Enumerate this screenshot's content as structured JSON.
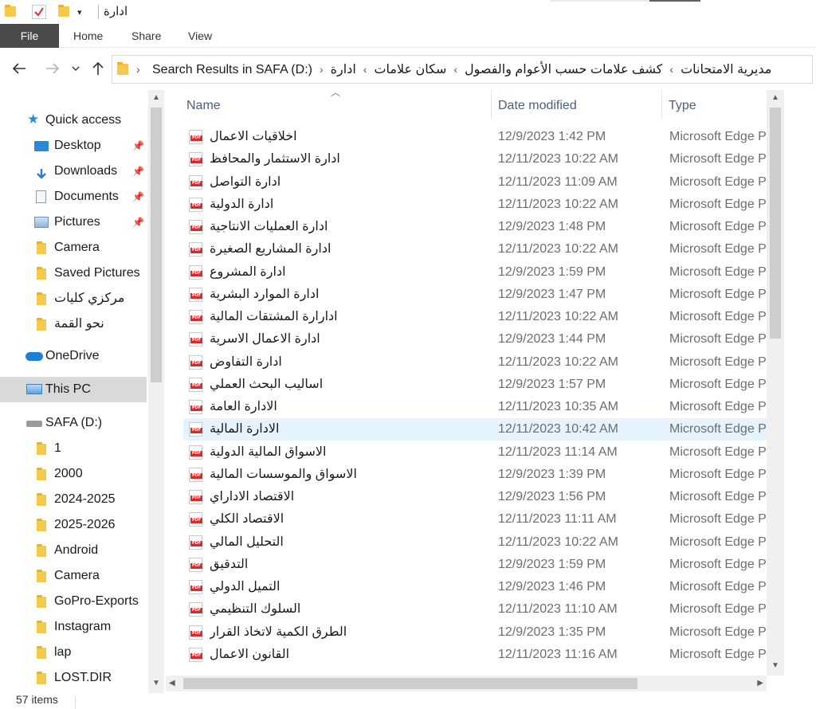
{
  "window": {
    "title": "ادارة"
  },
  "ribbon": {
    "tabs": [
      "File",
      "Home",
      "Share",
      "View"
    ]
  },
  "address": {
    "crumbs": [
      "Search Results in SAFA (D:)",
      "مديرية الامتحانات",
      "كشف علامات حسب الأعوام والفصول",
      "سكان علامات",
      "ادارة"
    ]
  },
  "nav": {
    "quick_access": "Quick access",
    "pinned": [
      {
        "label": "Desktop",
        "icon": "desktop-icon"
      },
      {
        "label": "Downloads",
        "icon": "download-icon"
      },
      {
        "label": "Documents",
        "icon": "document-icon"
      },
      {
        "label": "Pictures",
        "icon": "pictures-icon"
      }
    ],
    "folders": [
      "Camera",
      "Saved Pictures",
      "مركزي كليات",
      "نحو القمة"
    ],
    "onedrive": "OneDrive",
    "this_pc": "This PC",
    "drive": "SAFA (D:)",
    "drive_folders": [
      "1",
      "2000",
      "2024-2025",
      "2025-2026",
      "Android",
      "Camera",
      "GoPro-Exports",
      "Instagram",
      "lap",
      "LOST.DIR"
    ]
  },
  "columns": {
    "name": "Name",
    "date": "Date modified",
    "type": "Type"
  },
  "files": [
    {
      "name": "اخلاقيات الاعمال",
      "date": "12/9/2023 1:42 PM",
      "type": "Microsoft Edge P"
    },
    {
      "name": "ادارة الاستثمار والمحافظ",
      "date": "12/11/2023 10:22 AM",
      "type": "Microsoft Edge P"
    },
    {
      "name": "ادارة التواصل",
      "date": "12/11/2023 11:09 AM",
      "type": "Microsoft Edge P"
    },
    {
      "name": "ادارة الدولية",
      "date": "12/11/2023 10:22 AM",
      "type": "Microsoft Edge P"
    },
    {
      "name": "ادارة العمليات الانتاجية",
      "date": "12/9/2023 1:48 PM",
      "type": "Microsoft Edge P"
    },
    {
      "name": "ادارة المشاريع الصغيرة",
      "date": "12/11/2023 10:22 AM",
      "type": "Microsoft Edge P"
    },
    {
      "name": "ادارة المشروع",
      "date": "12/9/2023 1:59 PM",
      "type": "Microsoft Edge P"
    },
    {
      "name": "ادارة الموارد البشرية",
      "date": "12/9/2023 1:47 PM",
      "type": "Microsoft Edge P"
    },
    {
      "name": "ادارارة المشتقات المالية",
      "date": "12/11/2023 10:22 AM",
      "type": "Microsoft Edge P"
    },
    {
      "name": "ادارة الاعمال الاسرية",
      "date": "12/9/2023 1:44 PM",
      "type": "Microsoft Edge P"
    },
    {
      "name": "ادارة التفاوض",
      "date": "12/11/2023 10:22 AM",
      "type": "Microsoft Edge P"
    },
    {
      "name": "اساليب البحث العملي",
      "date": "12/9/2023 1:57 PM",
      "type": "Microsoft Edge P"
    },
    {
      "name": "الادارة العامة",
      "date": "12/11/2023 10:35 AM",
      "type": "Microsoft Edge P"
    },
    {
      "name": "الادارة المالية",
      "date": "12/11/2023 10:42 AM",
      "type": "Microsoft Edge P"
    },
    {
      "name": "الاسواق المالية الدولية",
      "date": "12/11/2023 11:14 AM",
      "type": "Microsoft Edge P"
    },
    {
      "name": "الاسواق والموسسات المالية",
      "date": "12/9/2023 1:39 PM",
      "type": "Microsoft Edge P"
    },
    {
      "name": "الاقتصاد الاداراي",
      "date": "12/9/2023 1:56 PM",
      "type": "Microsoft Edge P"
    },
    {
      "name": "الاقتصاد الكلي",
      "date": "12/11/2023 11:11 AM",
      "type": "Microsoft Edge P"
    },
    {
      "name": "التحليل المالي",
      "date": "12/11/2023 10:22 AM",
      "type": "Microsoft Edge P"
    },
    {
      "name": "التدقيق",
      "date": "12/9/2023 1:59 PM",
      "type": "Microsoft Edge P"
    },
    {
      "name": "التميل الدولي",
      "date": "12/9/2023 1:46 PM",
      "type": "Microsoft Edge P"
    },
    {
      "name": "السلوك التنظيمي",
      "date": "12/11/2023 11:10 AM",
      "type": "Microsoft Edge P"
    },
    {
      "name": "الطرق الكمية لاتخاذ القرار",
      "date": "12/9/2023 1:35 PM",
      "type": "Microsoft Edge P"
    },
    {
      "name": "القانون الاعمال",
      "date": "12/11/2023 11:16 AM",
      "type": "Microsoft Edge P"
    }
  ],
  "selected_index": 13,
  "status": {
    "count": "57 items"
  },
  "colors": {
    "accent": "#0078d4",
    "selection": "#e5f3ff",
    "file_tab": "#4a4a4a",
    "folder": "#f6c94a",
    "pdf_red": "#d62b2b"
  }
}
